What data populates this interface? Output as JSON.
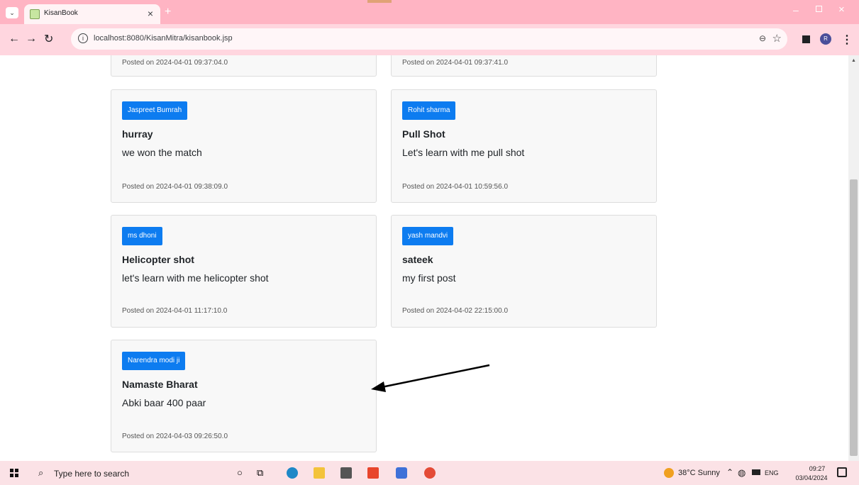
{
  "browser": {
    "tab_title": "KisanBook",
    "tab_close": "×",
    "new_tab": "+",
    "url": "localhost:8080/KisanMitra/kisanbook.jsp"
  },
  "posts": [
    {
      "author": "",
      "title": "",
      "content": "",
      "posted_on": "Posted on 2024-04-01 09:37:04.0"
    },
    {
      "author": "",
      "title": "",
      "content": "",
      "posted_on": "Posted on 2024-04-01 09:37:41.0"
    },
    {
      "author": "Jaspreet Bumrah",
      "title": "hurray",
      "content": "we won the match",
      "posted_on": "Posted on 2024-04-01 09:38:09.0"
    },
    {
      "author": "Rohit sharma",
      "title": "Pull Shot",
      "content": "Let's learn with me pull shot",
      "posted_on": "Posted on 2024-04-01 10:59:56.0"
    },
    {
      "author": "ms dhoni",
      "title": "Helicopter shot",
      "content": "let's learn with me helicopter shot",
      "posted_on": "Posted on 2024-04-01 11:17:10.0"
    },
    {
      "author": "yash mandvi",
      "title": "sateek",
      "content": "my first post",
      "posted_on": "Posted on 2024-04-02 22:15:00.0"
    },
    {
      "author": "Narendra modi ji",
      "title": "Namaste Bharat",
      "content": "Abki baar 400 paar",
      "posted_on": "Posted on 2024-04-03 09:26:50.0"
    }
  ],
  "taskbar": {
    "search_placeholder": "Type here to search",
    "weather": "38°C Sunny",
    "lang": "ENG",
    "time": "09:27",
    "date": "03/04/2024"
  },
  "icons": {
    "avatar_letter": "R"
  },
  "colors": {
    "tabstrip": "#ffb4c3",
    "author_badge": "#0d7cf0",
    "card_bg": "#f8f8f8"
  }
}
